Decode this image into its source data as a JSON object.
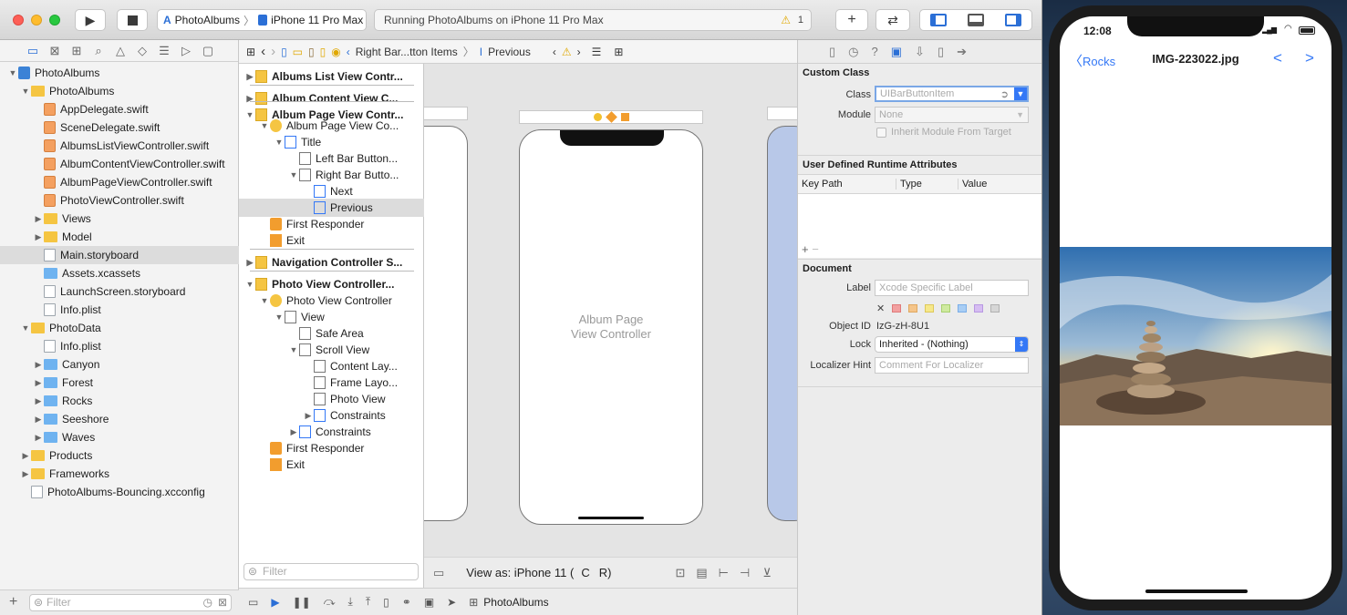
{
  "toolbar": {
    "scheme_app": "PhotoAlbums",
    "scheme_device": "iPhone 11 Pro Max",
    "activity": "Running PhotoAlbums on iPhone 11 Pro Max",
    "warning_count": "1"
  },
  "navigator": {
    "items": [
      {
        "label": "PhotoAlbums",
        "level": 0,
        "kind": "project",
        "open": true
      },
      {
        "label": "PhotoAlbums",
        "level": 1,
        "kind": "folder",
        "open": true
      },
      {
        "label": "AppDelegate.swift",
        "level": 2,
        "kind": "swift"
      },
      {
        "label": "SceneDelegate.swift",
        "level": 2,
        "kind": "swift"
      },
      {
        "label": "AlbumsListViewController.swift",
        "level": 2,
        "kind": "swift"
      },
      {
        "label": "AlbumContentViewController.swift",
        "level": 2,
        "kind": "swift"
      },
      {
        "label": "AlbumPageViewController.swift",
        "level": 2,
        "kind": "swift"
      },
      {
        "label": "PhotoViewController.swift",
        "level": 2,
        "kind": "swift"
      },
      {
        "label": "Views",
        "level": 2,
        "kind": "folder",
        "closed": true
      },
      {
        "label": "Model",
        "level": 2,
        "kind": "folder",
        "closed": true
      },
      {
        "label": "Main.storyboard",
        "level": 2,
        "kind": "file",
        "selected": true
      },
      {
        "label": "Assets.xcassets",
        "level": 2,
        "kind": "bluefolder"
      },
      {
        "label": "LaunchScreen.storyboard",
        "level": 2,
        "kind": "file"
      },
      {
        "label": "Info.plist",
        "level": 2,
        "kind": "file"
      },
      {
        "label": "PhotoData",
        "level": 1,
        "kind": "folder",
        "open": true
      },
      {
        "label": "Info.plist",
        "level": 2,
        "kind": "file"
      },
      {
        "label": "Canyon",
        "level": 2,
        "kind": "bluefolder",
        "closed": true
      },
      {
        "label": "Forest",
        "level": 2,
        "kind": "bluefolder",
        "closed": true
      },
      {
        "label": "Rocks",
        "level": 2,
        "kind": "bluefolder",
        "closed": true
      },
      {
        "label": "Seeshore",
        "level": 2,
        "kind": "bluefolder",
        "closed": true
      },
      {
        "label": "Waves",
        "level": 2,
        "kind": "bluefolder",
        "closed": true
      },
      {
        "label": "Products",
        "level": 1,
        "kind": "folder",
        "closed": true
      },
      {
        "label": "Frameworks",
        "level": 1,
        "kind": "folder",
        "closed": true
      },
      {
        "label": "PhotoAlbums-Bouncing.xcconfig",
        "level": 1,
        "kind": "file"
      }
    ],
    "filter_placeholder": "Filter"
  },
  "jumpbar": {
    "crumb1": "Right Bar...tton Items",
    "crumb2": "Previous"
  },
  "outline": {
    "items": [
      {
        "label": "Albums List View Contr...",
        "level": 0,
        "bold": true,
        "closed": true
      },
      {
        "label": "Album Content View C...",
        "level": 0,
        "bold": true,
        "closed": true
      },
      {
        "label": "Album Page View Contr...",
        "level": 0,
        "bold": true,
        "open": true
      },
      {
        "label": "Album Page View Co...",
        "level": 1,
        "open": true
      },
      {
        "label": "Title",
        "level": 2,
        "open": true
      },
      {
        "label": "Left Bar Button...",
        "level": 3
      },
      {
        "label": "Right Bar Butto...",
        "level": 3,
        "open": true
      },
      {
        "label": "Next",
        "level": 4
      },
      {
        "label": "Previous",
        "level": 4,
        "selected": true
      },
      {
        "label": "First Responder",
        "level": 1
      },
      {
        "label": "Exit",
        "level": 1
      },
      {
        "label": "Navigation Controller S...",
        "level": 0,
        "bold": true,
        "closed": true
      },
      {
        "label": "Photo View Controller...",
        "level": 0,
        "bold": true,
        "open": true
      },
      {
        "label": "Photo View Controller",
        "level": 1,
        "open": true
      },
      {
        "label": "View",
        "level": 2,
        "open": true
      },
      {
        "label": "Safe Area",
        "level": 3
      },
      {
        "label": "Scroll View",
        "level": 3,
        "open": true
      },
      {
        "label": "Content Lay...",
        "level": 4
      },
      {
        "label": "Frame Layo...",
        "level": 4
      },
      {
        "label": "Photo View",
        "level": 4
      },
      {
        "label": "Constraints",
        "level": 4,
        "closed": true
      },
      {
        "label": "Constraints",
        "level": 3,
        "closed": true
      },
      {
        "label": "First Responder",
        "level": 1
      },
      {
        "label": "Exit",
        "level": 1
      }
    ],
    "filter_placeholder": "Filter"
  },
  "canvas": {
    "scene_label_1": "Album Page",
    "scene_label_2": "View Controller",
    "view_as": "View as: iPhone 11 (",
    "view_as_c": "C",
    "view_as_r": "R)"
  },
  "bottombar": {
    "target": "PhotoAlbums"
  },
  "inspector": {
    "custom_class": "Custom Class",
    "class_label": "Class",
    "class_placeholder": "UIBarButtonItem",
    "module_label": "Module",
    "module_value": "None",
    "inherit_label": "Inherit Module From Target",
    "udra": "User Defined Runtime Attributes",
    "col_keypath": "Key Path",
    "col_type": "Type",
    "col_value": "Value",
    "document": "Document",
    "label_label": "Label",
    "label_placeholder": "Xcode Specific Label",
    "objid_label": "Object ID",
    "objid_value": "IzG-zH-8U1",
    "lock_label": "Lock",
    "lock_value": "Inherited - (Nothing)",
    "hint_label": "Localizer Hint",
    "hint_placeholder": "Comment For Localizer"
  },
  "simulator": {
    "time": "12:08",
    "back_label": "Rocks",
    "title": "IMG-223022.jpg",
    "prev": "<",
    "next": ">"
  }
}
